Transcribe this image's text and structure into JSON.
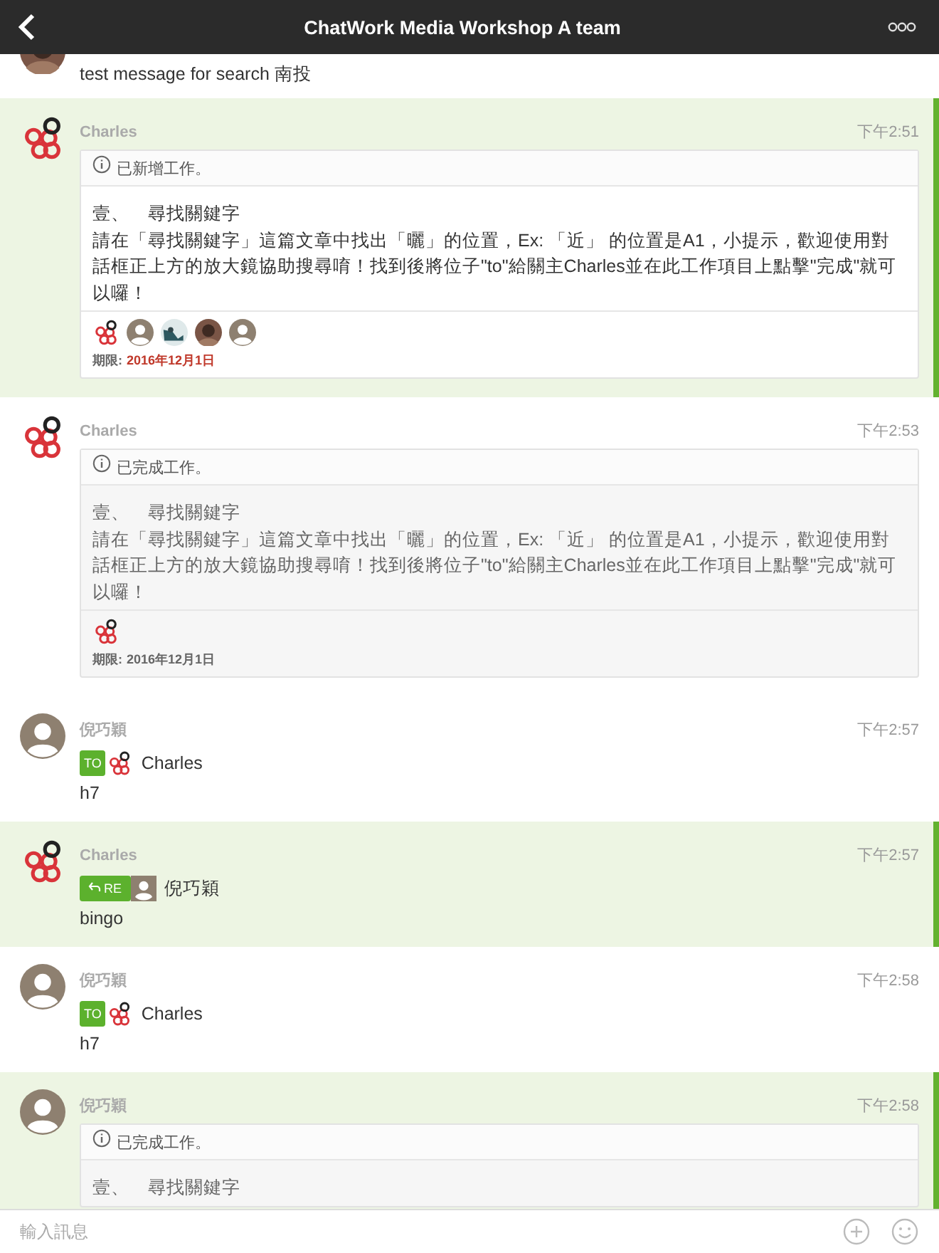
{
  "header": {
    "title": "ChatWork Media Workshop A team"
  },
  "messages": [
    {
      "kind": "text",
      "partial": true,
      "highlighted": false,
      "avatar": {
        "kind": "photo"
      },
      "text": "test message for search 南投"
    },
    {
      "kind": "task",
      "partial": false,
      "highlighted": true,
      "avatar": {
        "kind": "logo"
      },
      "name": "Charles",
      "time": "下午2:51",
      "task": {
        "done": false,
        "status": "已新增工作。",
        "title": "壹、　尋找關鍵字",
        "body": "請在「尋找關鍵字」這篇文章中找出「曬」的位置，Ex: 「近」 的位置是A1，小提示，歡迎使用對話框正上方的放大鏡協助搜尋唷！找到後將位子\"to\"給關主Charles並在此工作項目上點擊\"完成\"就可以囉！",
        "assignees": [
          {
            "kind": "logo"
          },
          {
            "kind": "person"
          },
          {
            "kind": "photo-teal"
          },
          {
            "kind": "photo"
          },
          {
            "kind": "person"
          }
        ],
        "due_label": "期限:",
        "due": "2016年12月1日"
      }
    },
    {
      "kind": "task",
      "partial": false,
      "highlighted": false,
      "avatar": {
        "kind": "logo"
      },
      "name": "Charles",
      "time": "下午2:53",
      "task": {
        "done": true,
        "status": "已完成工作。",
        "title": "壹、　尋找關鍵字",
        "body": "請在「尋找關鍵字」這篇文章中找出「曬」的位置，Ex: 「近」 的位置是A1，小提示，歡迎使用對話框正上方的放大鏡協助搜尋唷！找到後將位子\"to\"給關主Charles並在此工作項目上點擊\"完成\"就可以囉！",
        "assignees": [
          {
            "kind": "logo"
          }
        ],
        "due_label": "期限:",
        "due": "2016年12月1日"
      }
    },
    {
      "kind": "to",
      "partial": false,
      "highlighted": false,
      "avatar": {
        "kind": "person"
      },
      "name": "倪巧穎",
      "time": "下午2:57",
      "tag": "TO",
      "target_avatar": {
        "kind": "logo"
      },
      "target": "Charles",
      "text": "h7"
    },
    {
      "kind": "re",
      "partial": false,
      "highlighted": true,
      "avatar": {
        "kind": "logo"
      },
      "name": "Charles",
      "time": "下午2:57",
      "tag": "RE",
      "target_avatar": {
        "kind": "person"
      },
      "target": "倪巧穎",
      "text": "bingo"
    },
    {
      "kind": "to",
      "partial": false,
      "highlighted": false,
      "avatar": {
        "kind": "person"
      },
      "name": "倪巧穎",
      "time": "下午2:58",
      "tag": "TO",
      "target_avatar": {
        "kind": "logo"
      },
      "target": "Charles",
      "text": "h7"
    },
    {
      "kind": "task",
      "partial": false,
      "highlighted": true,
      "avatar": {
        "kind": "person"
      },
      "name": "倪巧穎",
      "time": "下午2:58",
      "task": {
        "done": true,
        "status": "已完成工作。",
        "title": "壹、　尋找關鍵字"
      }
    }
  ],
  "composer": {
    "placeholder": "輸入訊息"
  }
}
